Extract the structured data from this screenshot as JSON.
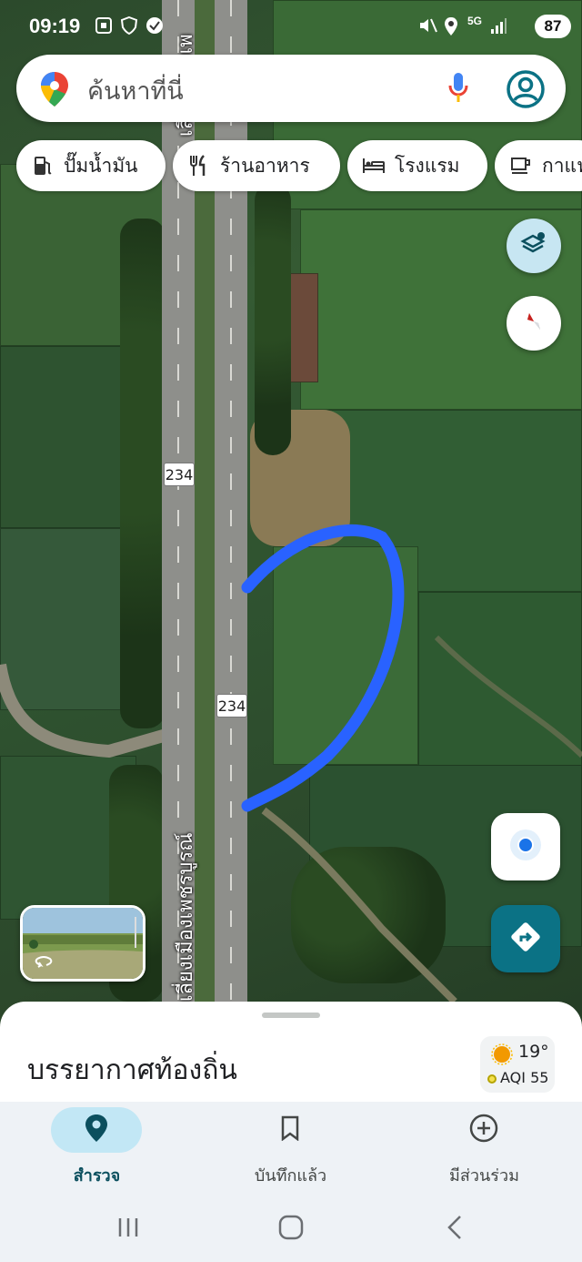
{
  "status_bar": {
    "time": "09:19",
    "network": "5G",
    "battery": "87"
  },
  "search": {
    "placeholder": "ค้นหาที่นี่"
  },
  "chips": [
    {
      "label": "ปั๊มน้ำมัน",
      "icon": "gas-station-icon"
    },
    {
      "label": "ร้านอาหาร",
      "icon": "restaurant-icon"
    },
    {
      "label": "โรงแรม",
      "icon": "hotel-icon"
    },
    {
      "label": "กาแฟ",
      "icon": "coffee-icon"
    }
  ],
  "map": {
    "route_shield_top": "234",
    "route_shield_bottom": "234",
    "road_name": "เลี่ยงเมืองเพชรบูรณ์",
    "road_name_top": "เลี่ยงเมืองเพ",
    "route_line_color": "#2962ff"
  },
  "bottom_sheet": {
    "title": "บรรยากาศท้องถิ่น",
    "temperature": "19°",
    "aqi": "AQI 55"
  },
  "bottom_nav": [
    {
      "label": "สำรวจ",
      "icon": "location-pin-icon",
      "active": true
    },
    {
      "label": "บันทึกแล้ว",
      "icon": "bookmark-icon",
      "active": false
    },
    {
      "label": "มีส่วนร่วม",
      "icon": "add-circle-icon",
      "active": false
    }
  ],
  "colors": {
    "accent_teal": "#0b7285",
    "active_pill": "#c2e7f5",
    "fab_blue": "#c7e6f2"
  }
}
